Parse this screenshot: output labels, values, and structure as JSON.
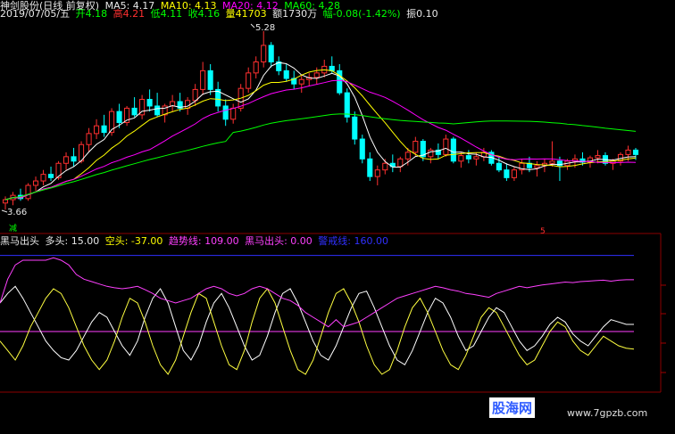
{
  "header": {
    "stock": "神剑股份(日线 前复权)",
    "ma5": "MA5: 4.17",
    "ma10": "MA10: 4.13",
    "ma20": "MA20: 4.12",
    "ma60": "MA60: 4.28",
    "date": "2019/07/05/五",
    "open": "开4.18",
    "high": "高4.21",
    "low": "低4.11",
    "close": "收4.16",
    "volume": "量41703",
    "amount": "额1730万",
    "change": "幅-0.08(-1.42%)",
    "amplitude": "振0.10"
  },
  "indicator": {
    "name": "黑马出头",
    "bull": "多头: 15.00",
    "bear": "空头: -37.00",
    "trend": "趋势线: 109.00",
    "signal": "黑马出头: 0.00",
    "warn": "警戒线: 160.00"
  },
  "annotations": {
    "high_label": "5.28",
    "low_label": "3.66",
    "low_mark": "减",
    "mark_5": "5"
  },
  "watermark": {
    "text": "股海网",
    "url": "www.7gpzb.com"
  },
  "colors": {
    "up": "#ff3030",
    "down": "#00ffff",
    "ma5": "#ffffff",
    "ma10": "#ffff00",
    "ma20": "#ff00ff",
    "ma60": "#00ff00",
    "bull": "#ffffff",
    "bear": "#ffff40",
    "trend": "#ff40ff",
    "warn": "#3030ff"
  },
  "chart_data": [
    {
      "type": "candlestick",
      "title": "神剑股份(日线 前复权)",
      "ylim": [
        3.5,
        5.4
      ],
      "candles": [
        [
          3.72,
          3.78,
          3.66,
          3.75
        ],
        [
          3.75,
          3.82,
          3.7,
          3.79
        ],
        [
          3.79,
          3.85,
          3.74,
          3.76
        ],
        [
          3.76,
          3.9,
          3.74,
          3.88
        ],
        [
          3.88,
          3.96,
          3.83,
          3.92
        ],
        [
          3.92,
          4.02,
          3.88,
          3.98
        ],
        [
          3.98,
          4.05,
          3.92,
          3.95
        ],
        [
          3.95,
          4.1,
          3.93,
          4.08
        ],
        [
          4.08,
          4.18,
          4.02,
          4.14
        ],
        [
          4.14,
          4.22,
          4.05,
          4.1
        ],
        [
          4.1,
          4.28,
          4.08,
          4.25
        ],
        [
          4.25,
          4.4,
          4.18,
          4.35
        ],
        [
          4.35,
          4.48,
          4.3,
          4.42
        ],
        [
          4.42,
          4.52,
          4.32,
          4.36
        ],
        [
          4.36,
          4.58,
          4.33,
          4.55
        ],
        [
          4.55,
          4.62,
          4.4,
          4.45
        ],
        [
          4.45,
          4.6,
          4.42,
          4.58
        ],
        [
          4.58,
          4.68,
          4.5,
          4.52
        ],
        [
          4.52,
          4.7,
          4.48,
          4.66
        ],
        [
          4.66,
          4.75,
          4.55,
          4.6
        ],
        [
          4.6,
          4.72,
          4.5,
          4.52
        ],
        [
          4.52,
          4.62,
          4.45,
          4.6
        ],
        [
          4.6,
          4.7,
          4.55,
          4.64
        ],
        [
          4.64,
          4.72,
          4.55,
          4.58
        ],
        [
          4.58,
          4.68,
          4.52,
          4.65
        ],
        [
          4.65,
          4.8,
          4.6,
          4.75
        ],
        [
          4.75,
          5.0,
          4.7,
          4.92
        ],
        [
          4.92,
          4.98,
          4.7,
          4.75
        ],
        [
          4.75,
          4.82,
          4.55,
          4.6
        ],
        [
          4.6,
          4.66,
          4.42,
          4.48
        ],
        [
          4.48,
          4.62,
          4.44,
          4.58
        ],
        [
          4.58,
          4.8,
          4.55,
          4.76
        ],
        [
          4.76,
          4.95,
          4.72,
          4.9
        ],
        [
          4.9,
          5.05,
          4.85,
          5.0
        ],
        [
          5.0,
          5.28,
          4.95,
          5.15
        ],
        [
          5.15,
          5.18,
          4.95,
          5.0
        ],
        [
          5.0,
          5.05,
          4.88,
          4.92
        ],
        [
          4.92,
          4.98,
          4.82,
          4.85
        ],
        [
          4.85,
          4.92,
          4.75,
          4.8
        ],
        [
          4.8,
          4.88,
          4.72,
          4.84
        ],
        [
          4.84,
          4.9,
          4.78,
          4.86
        ],
        [
          4.86,
          4.95,
          4.8,
          4.9
        ],
        [
          4.9,
          5.02,
          4.86,
          4.96
        ],
        [
          4.96,
          5.05,
          4.9,
          4.92
        ],
        [
          4.92,
          4.98,
          4.7,
          4.72
        ],
        [
          4.72,
          4.76,
          4.45,
          4.5
        ],
        [
          4.5,
          4.55,
          4.25,
          4.3
        ],
        [
          4.3,
          4.34,
          4.08,
          4.12
        ],
        [
          4.12,
          4.18,
          3.92,
          3.96
        ],
        [
          3.96,
          4.06,
          3.88,
          4.02
        ],
        [
          4.02,
          4.12,
          3.98,
          4.08
        ],
        [
          4.08,
          4.16,
          4.0,
          4.05
        ],
        [
          4.05,
          4.14,
          4.0,
          4.12
        ],
        [
          4.12,
          4.22,
          4.06,
          4.18
        ],
        [
          4.18,
          4.32,
          4.14,
          4.28
        ],
        [
          4.28,
          4.3,
          4.1,
          4.14
        ],
        [
          4.14,
          4.22,
          4.08,
          4.2
        ],
        [
          4.2,
          4.26,
          4.12,
          4.16
        ],
        [
          4.16,
          4.34,
          4.14,
          4.3
        ],
        [
          4.3,
          4.32,
          4.08,
          4.1
        ],
        [
          4.1,
          4.18,
          4.04,
          4.15
        ],
        [
          4.15,
          4.2,
          4.08,
          4.12
        ],
        [
          4.12,
          4.18,
          4.06,
          4.14
        ],
        [
          4.14,
          4.22,
          4.1,
          4.18
        ],
        [
          4.18,
          4.2,
          4.06,
          4.08
        ],
        [
          4.08,
          4.14,
          4.0,
          4.02
        ],
        [
          4.02,
          4.08,
          3.92,
          3.95
        ],
        [
          3.95,
          4.05,
          3.92,
          4.02
        ],
        [
          4.02,
          4.12,
          3.98,
          4.08
        ],
        [
          4.08,
          4.14,
          4.0,
          4.04
        ],
        [
          4.04,
          4.1,
          3.96,
          4.06
        ],
        [
          4.06,
          4.12,
          4.0,
          4.08
        ],
        [
          4.08,
          4.28,
          4.05,
          4.1
        ],
        [
          4.1,
          4.14,
          3.92,
          4.06
        ],
        [
          4.06,
          4.12,
          4.02,
          4.1
        ],
        [
          4.1,
          4.16,
          4.04,
          4.12
        ],
        [
          4.12,
          4.18,
          4.06,
          4.09
        ],
        [
          4.09,
          4.15,
          4.04,
          4.13
        ],
        [
          4.13,
          4.2,
          4.08,
          4.15
        ],
        [
          4.15,
          4.18,
          4.06,
          4.08
        ],
        [
          4.08,
          4.12,
          4.02,
          4.1
        ],
        [
          4.1,
          4.18,
          4.06,
          4.16
        ],
        [
          4.16,
          4.24,
          4.1,
          4.2
        ],
        [
          4.2,
          4.22,
          4.11,
          4.16
        ]
      ],
      "series_names": [
        "MA5",
        "MA10",
        "MA20",
        "MA60"
      ]
    },
    {
      "type": "line",
      "title": "黑马出头",
      "ylim": [
        -120,
        180
      ],
      "series": [
        {
          "name": "多头",
          "values": [
            60,
            80,
            95,
            70,
            40,
            10,
            -20,
            -40,
            -55,
            -60,
            -40,
            -10,
            20,
            40,
            30,
            0,
            -30,
            -50,
            -20,
            30,
            70,
            90,
            60,
            10,
            -40,
            -60,
            -30,
            20,
            60,
            80,
            50,
            10,
            -30,
            -60,
            -50,
            -10,
            40,
            80,
            90,
            60,
            20,
            -20,
            -50,
            -60,
            -30,
            10,
            50,
            80,
            85,
            50,
            10,
            -30,
            -60,
            -70,
            -40,
            0,
            40,
            70,
            60,
            30,
            -10,
            -40,
            -30,
            0,
            30,
            50,
            40,
            10,
            -20,
            -40,
            -30,
            -10,
            15,
            30,
            20,
            -5,
            -20,
            -30,
            -10,
            10,
            25,
            20,
            15,
            15
          ]
        },
        {
          "name": "空头",
          "values": [
            -20,
            -40,
            -60,
            -30,
            10,
            40,
            70,
            90,
            80,
            50,
            10,
            -30,
            -60,
            -80,
            -60,
            -20,
            30,
            70,
            60,
            20,
            -30,
            -70,
            -90,
            -60,
            -10,
            40,
            80,
            70,
            20,
            -30,
            -70,
            -80,
            -40,
            20,
            70,
            90,
            60,
            10,
            -40,
            -80,
            -90,
            -60,
            -10,
            40,
            80,
            90,
            60,
            20,
            -30,
            -70,
            -90,
            -80,
            -40,
            10,
            50,
            70,
            40,
            0,
            -40,
            -70,
            -80,
            -50,
            -10,
            30,
            50,
            40,
            10,
            -20,
            -50,
            -70,
            -60,
            -30,
            0,
            20,
            10,
            -20,
            -40,
            -50,
            -30,
            -10,
            -20,
            -30,
            -35,
            -37
          ]
        },
        {
          "name": "趋势线",
          "values": [
            60,
            110,
            140,
            150,
            150,
            150,
            150,
            155,
            150,
            140,
            120,
            110,
            105,
            100,
            95,
            92,
            90,
            92,
            95,
            88,
            80,
            70,
            65,
            60,
            65,
            70,
            80,
            90,
            95,
            90,
            80,
            75,
            80,
            90,
            95,
            90,
            80,
            70,
            65,
            55,
            40,
            30,
            20,
            10,
            25,
            10,
            15,
            20,
            30,
            40,
            50,
            60,
            70,
            75,
            80,
            85,
            90,
            95,
            92,
            88,
            85,
            80,
            78,
            75,
            72,
            80,
            85,
            90,
            95,
            92,
            95,
            98,
            100,
            102,
            104,
            103,
            105,
            106,
            107,
            108,
            106,
            108,
            109,
            109
          ]
        }
      ],
      "reference_lines": [
        {
          "name": "黑马出头",
          "value": 0
        },
        {
          "name": "警戒线",
          "value": 160
        }
      ]
    }
  ]
}
